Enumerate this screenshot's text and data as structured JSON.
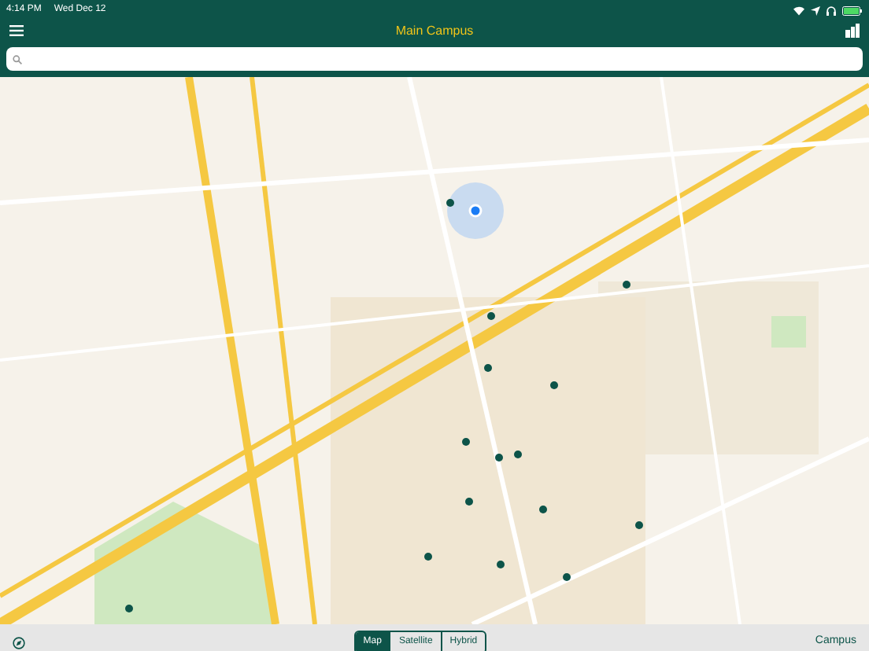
{
  "status_bar": {
    "time": "4:14 PM",
    "date": "Wed Dec 12"
  },
  "nav_bar": {
    "title": "Main Campus"
  },
  "map_types": [
    {
      "label": "Map",
      "selected": true
    },
    {
      "label": "Satellite",
      "selected": false
    },
    {
      "label": "Hybrid",
      "selected": false
    }
  ],
  "campus_button": "Campus"
}
